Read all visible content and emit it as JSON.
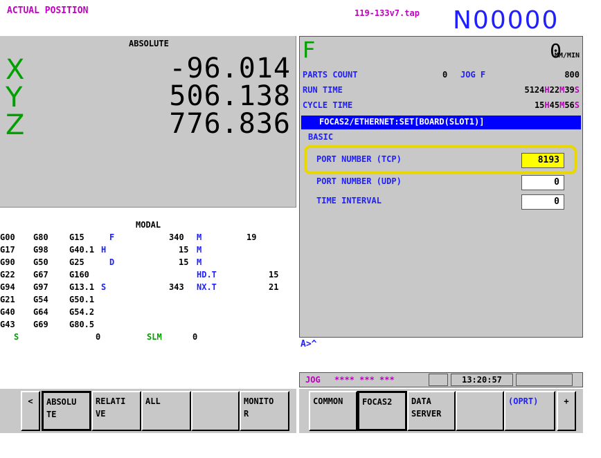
{
  "header": {
    "title": "ACTUAL POSITION",
    "file": "119-133v7.tap",
    "program": "N00000"
  },
  "position": {
    "mode_label": "ABSOLUTE",
    "axes": [
      {
        "axis": "X",
        "value": "-96.014"
      },
      {
        "axis": "Y",
        "value": "506.138"
      },
      {
        "axis": "Z",
        "value": "776.836"
      }
    ]
  },
  "modal": {
    "title": "MODAL",
    "g_codes": [
      [
        "G00",
        "G80",
        "G15"
      ],
      [
        "G17",
        "G98",
        "G40.1"
      ],
      [
        "G90",
        "G50",
        "G25"
      ],
      [
        "G22",
        "G67",
        "G160"
      ],
      [
        "G94",
        "G97",
        "G13.1"
      ],
      [
        "G21",
        "G54",
        "G50.1"
      ],
      [
        "G40",
        "G64",
        "G54.2"
      ],
      [
        "G43",
        "G69",
        "G80.5"
      ]
    ],
    "f_label": "F",
    "f_value": "340",
    "h1_label": "H",
    "h1_value": "15",
    "d_label": "D",
    "d_value": "15",
    "s_label": "S",
    "s_value": "343",
    "m1_label": "M",
    "m1_value": "19",
    "m2_label": "M",
    "m3_label": "M",
    "hdt_label": "HD.T",
    "hdt_value": "15",
    "nxt_label": "NX.T",
    "nxt_value": "21",
    "s2_label": "S",
    "s2_value": "0",
    "slm_label": "SLM",
    "slm_value": "0"
  },
  "feed": {
    "letter": "F",
    "value": "0",
    "unit": "MM/MIN"
  },
  "counters": {
    "parts_count_label": "PARTS COUNT",
    "parts_count_value": "0",
    "jog_f_label": "JOG F",
    "jog_f_value": "800",
    "run_time_label": "RUN TIME",
    "run_time_h": "5124",
    "run_time_m": "22",
    "run_time_s": "39",
    "cycle_time_label": "CYCLE TIME",
    "cycle_time_h": "15",
    "cycle_time_m": "45",
    "cycle_time_s": "56",
    "h_unit": "H",
    "m_unit": "M",
    "s_unit": "S"
  },
  "focas": {
    "title": "FOCAS2/ETHERNET:SET[BOARD(SLOT1)]",
    "section": "BASIC",
    "fields": [
      {
        "label": "PORT NUMBER (TCP)",
        "value": "8193"
      },
      {
        "label": "PORT NUMBER (UDP)",
        "value": "0"
      },
      {
        "label": "TIME INTERVAL",
        "value": "0"
      }
    ]
  },
  "prompt": "A>^",
  "status": {
    "mode": "JOG",
    "stars": "**** *** ***",
    "time": "13:20:57"
  },
  "softkeys_left": [
    "<",
    "ABSOLU\nTE",
    "RELATI\nVE",
    "ALL",
    "",
    "MONITO\nR"
  ],
  "softkeys_right": [
    "COMMON",
    "FOCAS2",
    "DATA\nSERVER",
    "",
    "(OPRT)",
    "+"
  ],
  "colors": {
    "panel_gray": "#c8c8c8",
    "accent_blue": "#2020ff",
    "axis_green": "#00a000",
    "highlight_yellow": "#e8d800",
    "input_yellow": "#ffff00"
  }
}
